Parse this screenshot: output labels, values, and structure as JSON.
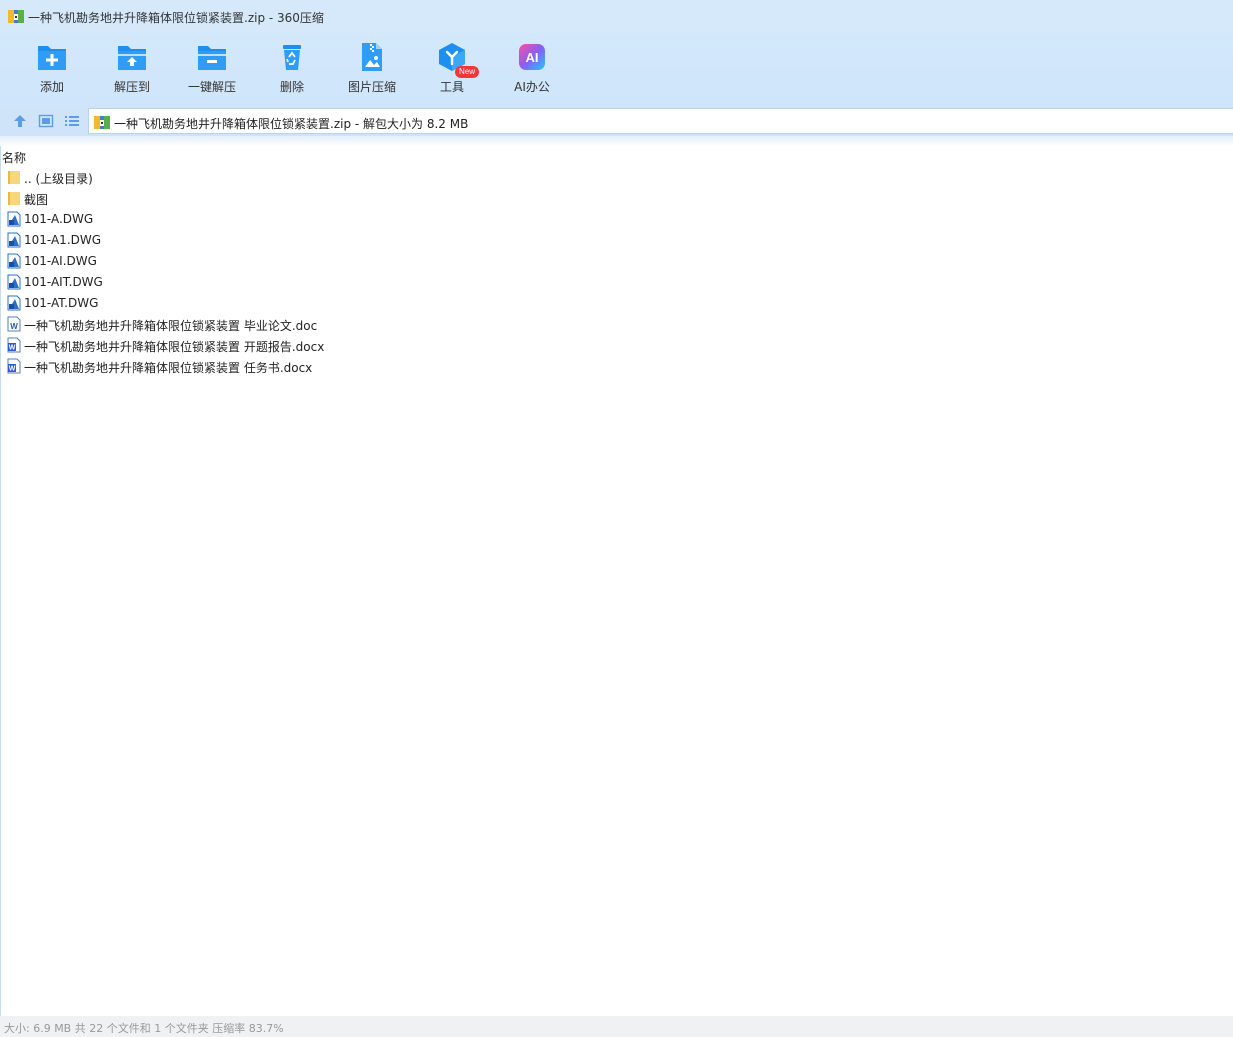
{
  "window": {
    "title": "一种飞机勘务地井升降箱体限位锁紧装置.zip - 360压缩",
    "icon": "archive-icon"
  },
  "toolbar": {
    "items": [
      {
        "label": "添加",
        "icon": "add-folder-icon"
      },
      {
        "label": "解压到",
        "icon": "extract-to-folder-icon"
      },
      {
        "label": "一键解压",
        "icon": "one-click-extract-icon"
      },
      {
        "label": "删除",
        "icon": "recycle-bin-icon"
      },
      {
        "label": "图片压缩",
        "icon": "image-compress-icon"
      },
      {
        "label": "工具",
        "icon": "tools-cube-icon"
      },
      {
        "label": "AI办公",
        "icon": "ai-office-icon"
      }
    ],
    "new_badge": "New"
  },
  "address": {
    "path": "一种飞机勘务地井升降箱体限位锁紧装置.zip - 解包大小为 8.2 MB"
  },
  "list": {
    "column_name": "名称",
    "items": [
      {
        "name": ".. (上级目录)",
        "type": "folder"
      },
      {
        "name": "截图",
        "type": "folder"
      },
      {
        "name": "101-A.DWG",
        "type": "dwg"
      },
      {
        "name": "101-A1.DWG",
        "type": "dwg"
      },
      {
        "name": "101-AI.DWG",
        "type": "dwg"
      },
      {
        "name": "101-AIT.DWG",
        "type": "dwg"
      },
      {
        "name": "101-AT.DWG",
        "type": "dwg"
      },
      {
        "name": "一种飞机勘务地井升降箱体限位锁紧装置 毕业论文.doc",
        "type": "doc"
      },
      {
        "name": "一种飞机勘务地井升降箱体限位锁紧装置 开题报告.docx",
        "type": "docx"
      },
      {
        "name": "一种飞机勘务地井升降箱体限位锁紧装置 任务书.docx",
        "type": "docx"
      }
    ]
  },
  "status": {
    "text": "大小: 6.9 MB 共 22 个文件和 1 个文件夹 压缩率 83.7%"
  },
  "colors": {
    "toolbar_bg": "#d3e8fb",
    "icon_blue": "#1d8ff0",
    "badge_red": "#f2363a"
  }
}
